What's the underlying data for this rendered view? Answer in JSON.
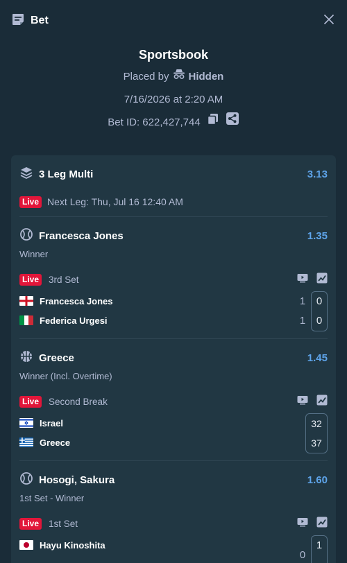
{
  "header": {
    "title": "Bet"
  },
  "summary": {
    "title": "Sportsbook",
    "placed_by_label": "Placed by",
    "placed_by_name": "Hidden",
    "date": "7/16/2026 at 2:20 AM",
    "bet_id": "Bet ID: 622,427,744"
  },
  "multi": {
    "title": "3 Leg Multi",
    "odds": "3.13",
    "live_label": "Live",
    "next_leg": "Next Leg: Thu, Jul 16 12:40 AM"
  },
  "legs": [
    {
      "title": "Francesca Jones",
      "odds": "1.35",
      "market": "Winner",
      "live_label": "Live",
      "status": "3rd Set",
      "teams": [
        {
          "name": "Francesca Jones",
          "set_score": "1",
          "game_score": "0"
        },
        {
          "name": "Federica Urgesi",
          "set_score": "1",
          "game_score": "0"
        }
      ]
    },
    {
      "title": "Greece",
      "odds": "1.45",
      "market": "Winner (Incl. Overtime)",
      "live_label": "Live",
      "status": "Second Break",
      "teams": [
        {
          "name": "Israel",
          "score": "32"
        },
        {
          "name": "Greece",
          "score": "37"
        }
      ]
    },
    {
      "title": "Hosogi, Sakura",
      "odds": "1.60",
      "market": "1st Set - Winner",
      "live_label": "Live",
      "status": "1st Set",
      "teams": [
        {
          "name": "Hayu Kinoshita",
          "set_score": "0",
          "game_score": "1"
        }
      ]
    }
  ],
  "colors": {
    "background": "#1a2c38",
    "card": "#213743",
    "accent": "#5ea4ea",
    "live": "#e2163a"
  },
  "icons": [
    "betslip-icon",
    "close-icon",
    "incognito-icon",
    "copy-icon",
    "share-icon",
    "layers-icon",
    "tennis-ball-icon",
    "basketball-icon",
    "live-stream-icon",
    "stats-chart-icon",
    "flag-england-icon",
    "flag-italy-icon",
    "flag-israel-icon",
    "flag-greece-icon",
    "flag-japan-icon"
  ]
}
